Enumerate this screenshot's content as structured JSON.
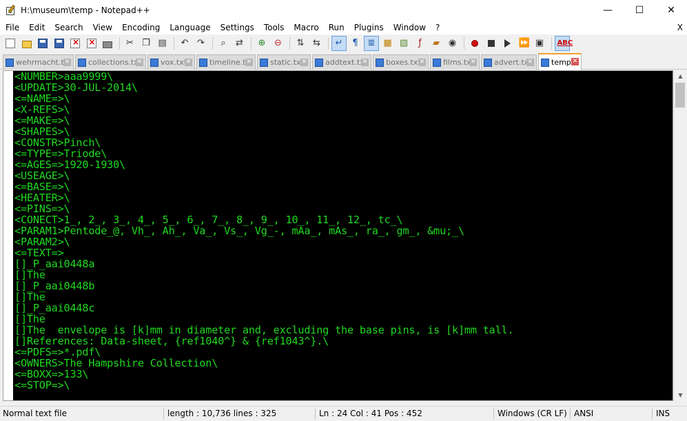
{
  "window": {
    "title": "H:\\museum\\temp - Notepad++",
    "minimize": "—",
    "maximize": "☐",
    "close": "✕"
  },
  "menu": {
    "items": [
      "File",
      "Edit",
      "Search",
      "View",
      "Encoding",
      "Language",
      "Settings",
      "Tools",
      "Macro",
      "Run",
      "Plugins",
      "Window",
      "?"
    ],
    "close": "X"
  },
  "toolbar": {
    "icons": [
      "new-file-icon",
      "open-file-icon",
      "save-icon",
      "save-all-icon",
      "close-file-icon",
      "close-all-icon",
      "print-icon",
      "cut-icon",
      "copy-icon",
      "paste-icon",
      "undo-icon",
      "redo-icon",
      "find-icon",
      "replace-icon",
      "zoom-in-icon",
      "zoom-out-icon",
      "sync-vertical-icon",
      "sync-horizontal-icon",
      "word-wrap-icon",
      "show-all-chars-icon",
      "indent-guide-icon",
      "user-language-icon",
      "doc-map-icon",
      "function-list-icon",
      "folder-workspace-icon",
      "monitoring-icon",
      "record-macro-icon",
      "stop-record-icon",
      "play-macro-icon",
      "run-macro-multiple-icon",
      "save-macro-icon",
      "spell-check-icon"
    ]
  },
  "tabs": [
    {
      "label": "wehrmacht.txt",
      "close": "✕"
    },
    {
      "label": "collections.txt",
      "close": "✕"
    },
    {
      "label": "vox.txt",
      "close": "✕"
    },
    {
      "label": "timeline.txt",
      "close": "✕"
    },
    {
      "label": "static.txt",
      "close": "✕"
    },
    {
      "label": "addtext.txt",
      "close": "✕"
    },
    {
      "label": "boxes.txt",
      "close": "✕"
    },
    {
      "label": "films.txt",
      "close": "✕"
    },
    {
      "label": "advert.txt",
      "close": "✕"
    },
    {
      "label": "temp",
      "close": "✕"
    }
  ],
  "active_tab": "temp",
  "editor": {
    "text_color": "#20d820",
    "background": "#000000",
    "lines": [
      "<NUMBER>aaa9999\\",
      "<UPDATE>30-JUL-2014\\",
      "<=NAME=>\\",
      "<X-REFS>\\",
      "<=MAKE=>\\",
      "<SHAPES>\\",
      "<CONSTR>Pinch\\",
      "<=TYPE=>Triode\\",
      "<=AGES=>1920-1930\\",
      "<USEAGE>\\",
      "<=BASE=>\\",
      "<HEATER>\\",
      "<=PINS=>\\",
      "<CONECT>1_, 2_, 3_, 4_, 5_, 6_, 7_, 8_, 9_, 10_, 11_, 12_, tc_\\",
      "<PARAM1>Pentode_@, Vh_, Ah_, Va_, Vs_, Vg_-, mAa_, mAs_, ra_, gm_, &mu;_\\",
      "<PARAM2>\\",
      "<=TEXT=>",
      "[]_P_aai0448a",
      "[]The",
      "[]_P_aai0448b",
      "[]The",
      "[]_P_aai0448c",
      "[]The",
      "[]The  envelope is [k]mm in diameter and, excluding the base pins, is [k]mm tall.",
      "[]References: Data-sheet, {ref1040^} & {ref1043^}.\\",
      "<=PDFS=>*.pdf\\",
      "<OWNERS>The Hampshire Collection\\",
      "<=BOXX=>133\\",
      "<=STOP=>\\"
    ]
  },
  "scrollbar": {
    "up": "▲",
    "down": "▼"
  },
  "status": {
    "file_type": "Normal text file",
    "length": "length : 10,736    lines : 325",
    "position": "Ln : 24    Col : 41    Pos : 452",
    "eol": "Windows (CR LF)",
    "encoding": "ANSI",
    "mode": "INS"
  }
}
